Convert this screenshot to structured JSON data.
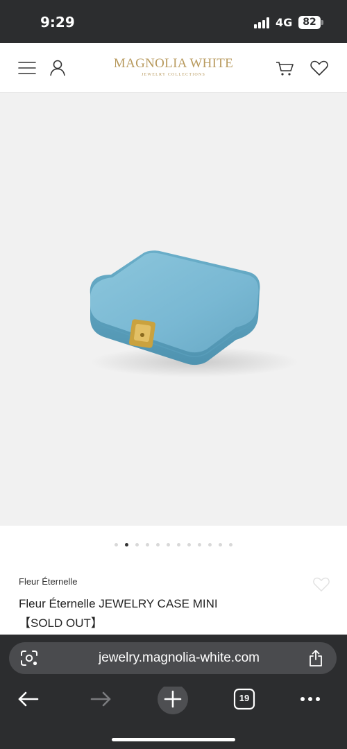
{
  "status": {
    "time": "9:29",
    "network": "4G",
    "battery": "82"
  },
  "header": {
    "logo_main": "MAGNOLIA WHITE",
    "logo_sub": "JEWELRY COLLECTIONS",
    "icons": [
      "menu-icon",
      "account-icon",
      "cart-icon",
      "heart-icon"
    ]
  },
  "gallery": {
    "slide_count": 12,
    "active_index": 1
  },
  "product": {
    "brand": "Fleur Éternelle",
    "title": "Fleur Éternelle JEWELRY CASE MINI",
    "status": "【SOLD OUT】"
  },
  "browser": {
    "url": "jewelry.magnolia-white.com",
    "tab_count": "19"
  },
  "colors": {
    "accent_gold": "#b89a5e",
    "bar_dark": "#2c2d2f",
    "case_blue": "#79b8d3"
  }
}
